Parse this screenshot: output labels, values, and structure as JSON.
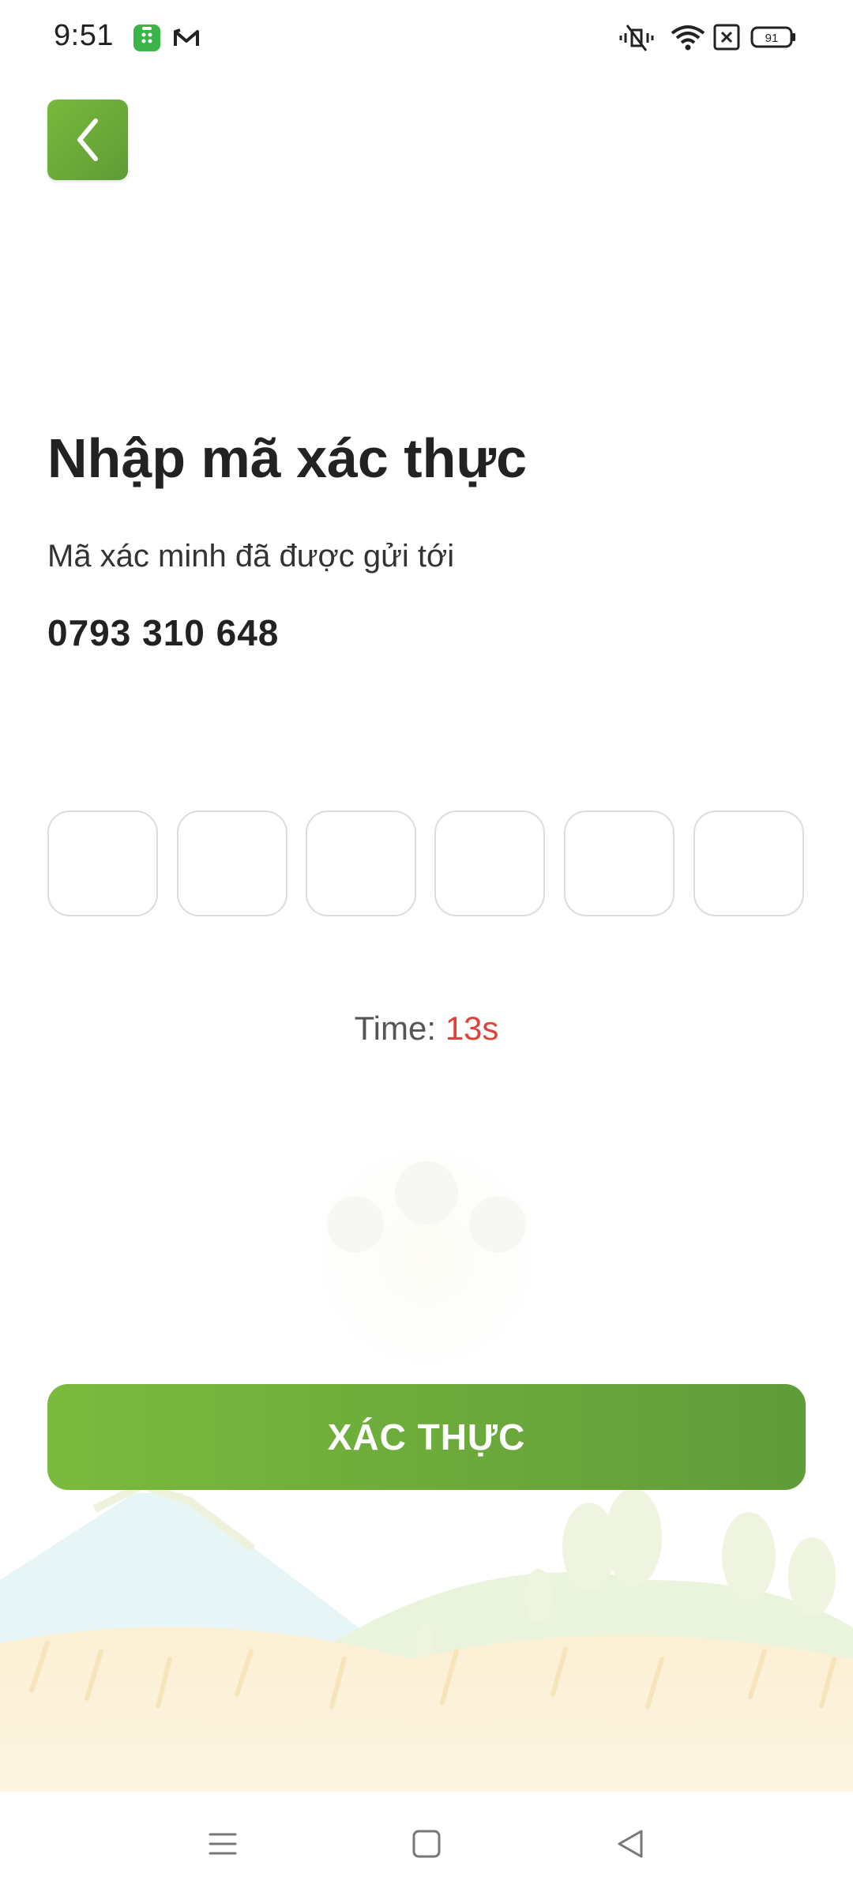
{
  "status_bar": {
    "time": "9:51",
    "battery_level": "91",
    "icons": [
      "app-shield-icon",
      "mail-m-icon",
      "vibrate-icon",
      "wifi-icon",
      "no-sim-icon",
      "battery-icon"
    ]
  },
  "header": {
    "back_icon": "chevron-left-icon"
  },
  "main": {
    "title": "Nhập mã xác thực",
    "subtitle": "Mã xác minh đã được gửi tới",
    "phone_number": "0793 310 648",
    "otp": {
      "length": 6,
      "values": [
        "",
        "",
        "",
        "",
        "",
        ""
      ]
    },
    "timer": {
      "label": "Time:",
      "value": "13s"
    },
    "verify_button_label": "XÁC THỰC"
  },
  "nav_bar": {
    "items": [
      "menu-icon",
      "home-square-icon",
      "back-triangle-icon"
    ]
  },
  "colors": {
    "brand_green": "#6aab3a",
    "timer_red": "#e0413b",
    "input_border": "#dcdcdc"
  }
}
